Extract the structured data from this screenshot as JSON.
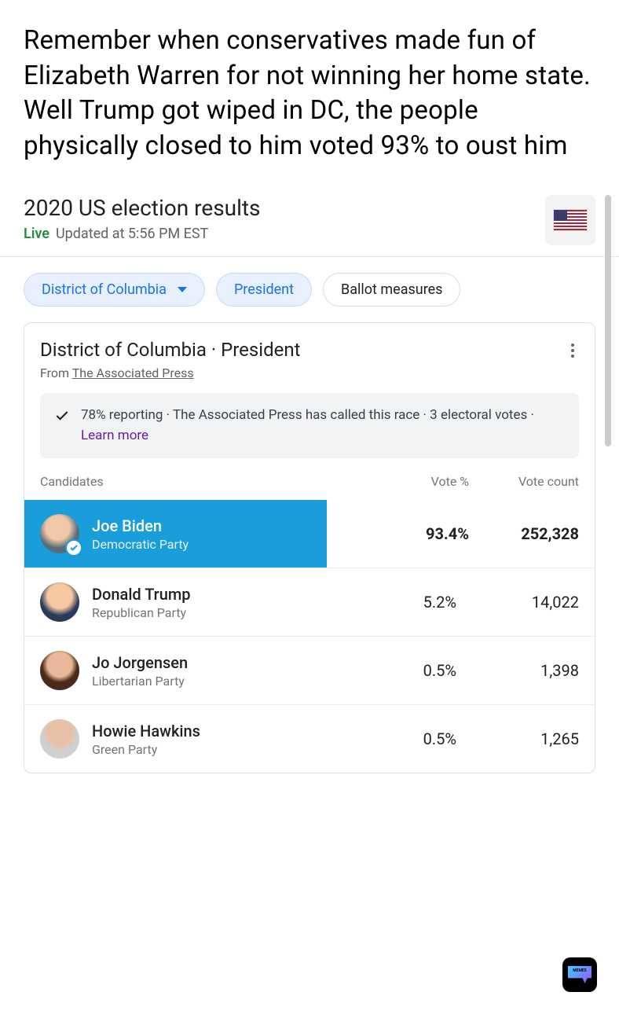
{
  "commentary": "Remember when conservatives made fun of Elizabeth Warren for not winning her home state. Well Trump got wiped in DC, the people physically closed to him voted 93% to oust him",
  "header": {
    "title": "2020 US election results",
    "live_label": "Live",
    "updated": "Updated at 5:56 PM EST"
  },
  "chips": {
    "region": "District of Columbia",
    "office": "President",
    "ballot": "Ballot measures"
  },
  "card": {
    "title": "District of Columbia · President",
    "source_prefix": "From ",
    "source_name": "The Associated Press",
    "status_text": "78% reporting · The Associated Press has called this race · 3 electoral votes · ",
    "learn_more": "Learn more"
  },
  "table": {
    "col_candidates": "Candidates",
    "col_pct": "Vote %",
    "col_count": "Vote count"
  },
  "candidates": [
    {
      "name": "Joe Biden",
      "party": "Democratic Party",
      "pct": "93.4%",
      "count": "252,328",
      "winner": true
    },
    {
      "name": "Donald Trump",
      "party": "Republican Party",
      "pct": "5.2%",
      "count": "14,022",
      "winner": false
    },
    {
      "name": "Jo Jorgensen",
      "party": "Libertarian Party",
      "pct": "0.5%",
      "count": "1,398",
      "winner": false
    },
    {
      "name": "Howie Hawkins",
      "party": "Green Party",
      "pct": "0.5%",
      "count": "1,265",
      "winner": false
    }
  ]
}
